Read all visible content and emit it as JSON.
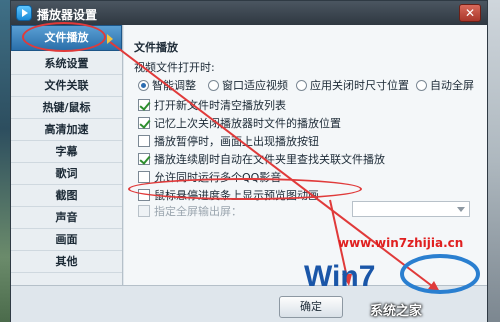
{
  "window": {
    "title": "播放器设置",
    "close_glyph": "✕"
  },
  "sidebar": {
    "items": [
      {
        "label": "文件播放",
        "active": true
      },
      {
        "label": "系统设置"
      },
      {
        "label": "文件关联"
      },
      {
        "label": "热键/鼠标"
      },
      {
        "label": "高清加速"
      },
      {
        "label": "字幕"
      },
      {
        "label": "歌词"
      },
      {
        "label": "截图"
      },
      {
        "label": "声音"
      },
      {
        "label": "画面"
      },
      {
        "label": "其他"
      }
    ]
  },
  "content": {
    "section_title": "文件播放",
    "open_label": "视频文件打开时:",
    "radios": [
      {
        "label": "智能调整",
        "selected": true
      },
      {
        "label": "窗口适应视频",
        "selected": false
      },
      {
        "label": "应用关闭时尺寸位置",
        "selected": false
      },
      {
        "label": "自动全屏",
        "selected": false
      }
    ],
    "checkboxes": [
      {
        "label": "打开新文件时清空播放列表",
        "checked": true,
        "disabled": false
      },
      {
        "label": "记忆上次关闭播放器时文件的播放位置",
        "checked": true,
        "disabled": false
      },
      {
        "label": "播放暂停时，画面上出现播放按钮",
        "checked": false,
        "disabled": false
      },
      {
        "label": "播放连续剧时自动在文件夹里查找关联文件播放",
        "checked": true,
        "disabled": false
      },
      {
        "label": "允许同时运行多个QQ影音",
        "checked": false,
        "disabled": false
      },
      {
        "label": "鼠标悬停进度条上显示预览图动画",
        "checked": false,
        "disabled": false
      },
      {
        "label": "指定全屏输出屏：",
        "checked": false,
        "disabled": true
      }
    ]
  },
  "footer": {
    "ok_label": "确定"
  },
  "watermark": {
    "url": "www.win7zhijia.cn",
    "site": "系统之家"
  },
  "colors": {
    "highlight": "#e03a3a",
    "accent": "#2a6faa"
  }
}
